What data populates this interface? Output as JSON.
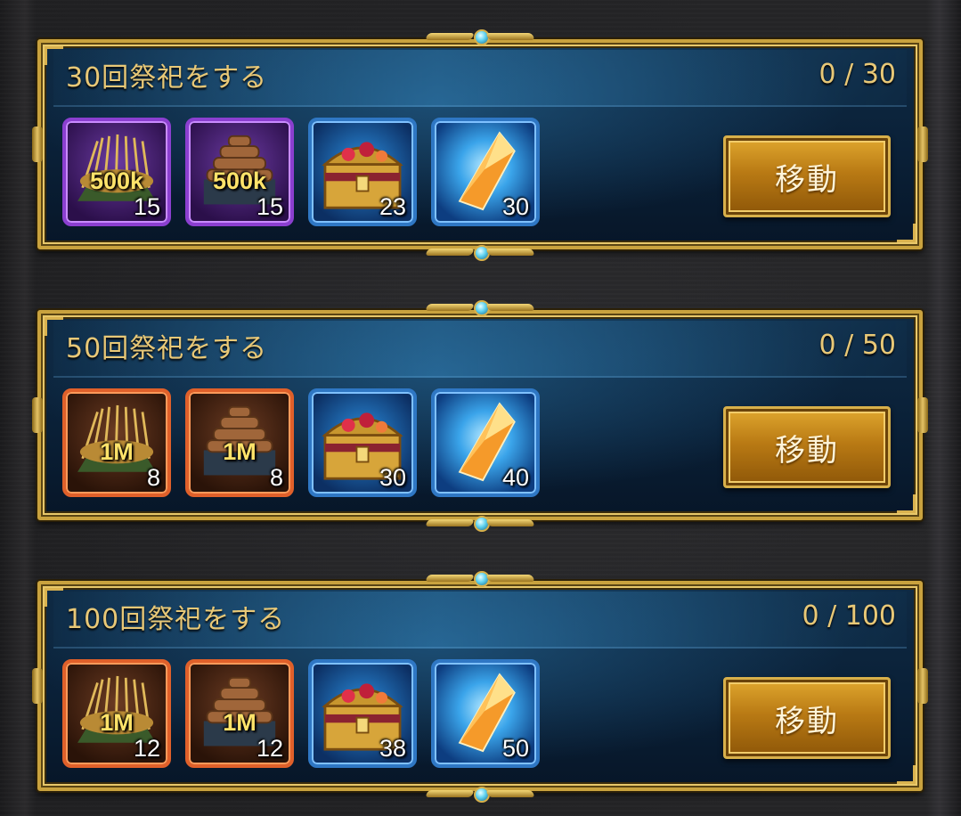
{
  "colors": {
    "gold_text": "#e8c877",
    "frame_gold": "#c9a23e",
    "panel_blue": "#0a2037",
    "purple_rarity": "#8b3fd0",
    "orange_rarity": "#e0602a",
    "blue_rarity": "#2f77c4",
    "amount_yellow": "#ffe36a",
    "button_gold": "#b97a14"
  },
  "quests": [
    {
      "title": "30回祭祀をする",
      "progress": "0 / 30",
      "button_label": "移動",
      "rewards": [
        {
          "icon": "grain-bundle-icon",
          "rarity": "purple",
          "amount": "500k",
          "count": "15"
        },
        {
          "icon": "lumber-pile-icon",
          "rarity": "purple",
          "amount": "500k",
          "count": "15"
        },
        {
          "icon": "treasure-chest-icon",
          "rarity": "blue",
          "amount": "",
          "count": "23"
        },
        {
          "icon": "orange-crystal-icon",
          "rarity": "blue",
          "amount": "",
          "count": "30"
        }
      ]
    },
    {
      "title": "50回祭祀をする",
      "progress": "0 / 50",
      "button_label": "移動",
      "rewards": [
        {
          "icon": "grain-bundle-icon",
          "rarity": "orange",
          "amount": "1M",
          "count": "8"
        },
        {
          "icon": "lumber-pile-icon",
          "rarity": "orange",
          "amount": "1M",
          "count": "8"
        },
        {
          "icon": "treasure-chest-icon",
          "rarity": "blue",
          "amount": "",
          "count": "30"
        },
        {
          "icon": "orange-crystal-icon",
          "rarity": "blue",
          "amount": "",
          "count": "40"
        }
      ]
    },
    {
      "title": "100回祭祀をする",
      "progress": "0 / 100",
      "button_label": "移動",
      "rewards": [
        {
          "icon": "grain-bundle-icon",
          "rarity": "orange",
          "amount": "1M",
          "count": "12"
        },
        {
          "icon": "lumber-pile-icon",
          "rarity": "orange",
          "amount": "1M",
          "count": "12"
        },
        {
          "icon": "treasure-chest-icon",
          "rarity": "blue",
          "amount": "",
          "count": "38"
        },
        {
          "icon": "orange-crystal-icon",
          "rarity": "blue",
          "amount": "",
          "count": "50"
        }
      ]
    }
  ]
}
